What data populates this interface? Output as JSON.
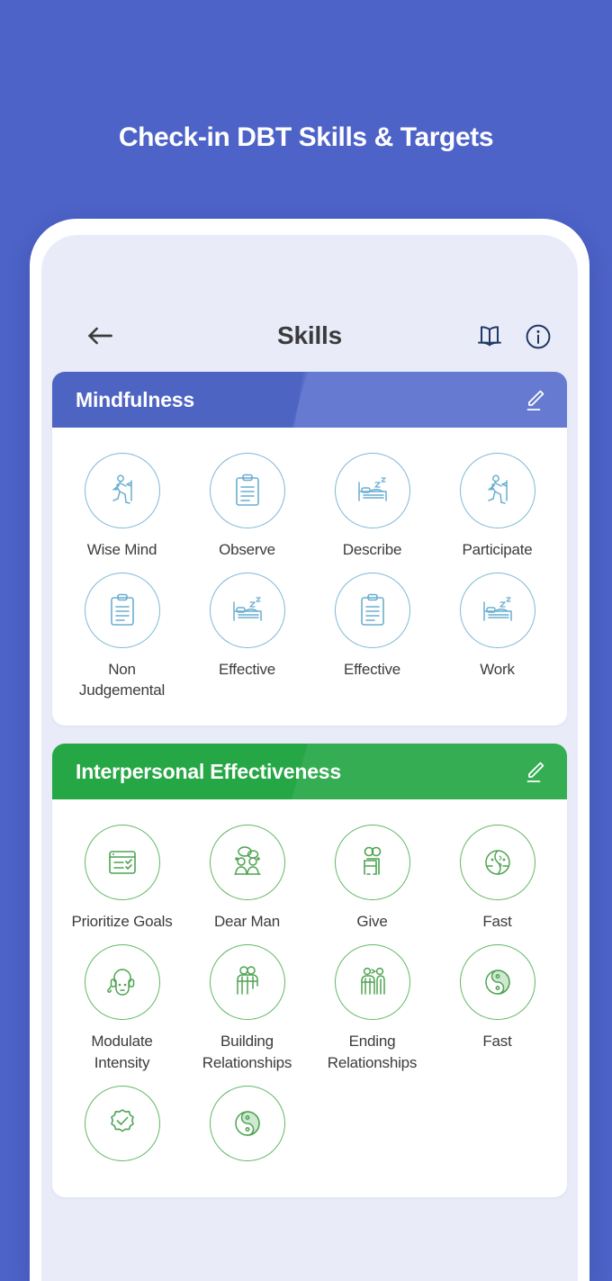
{
  "promo": {
    "title": "Check-in DBT Skills & Targets"
  },
  "colors": {
    "background_blue": "#4d63c8",
    "screen_bg": "#e9ecf8",
    "mindfulness_header": "#5068c4",
    "interpersonal_header": "#26a745",
    "mindfulness_icon": "#7fb9d6",
    "interpersonal_icon": "#4ea352",
    "label_text": "#3c3c3c",
    "header_icon": "#1f3864"
  },
  "app_header": {
    "title": "Skills",
    "back_icon": "back-arrow-icon",
    "book_icon": "book-icon",
    "info_icon": "info-icon"
  },
  "sections": [
    {
      "title": "Mindfulness",
      "theme": "blue",
      "edit_icon": "pencil-edit-icon",
      "skills": [
        {
          "label": "Wise Mind",
          "icon": "hiker-walking-icon"
        },
        {
          "label": "Observe",
          "icon": "clipboard-icon"
        },
        {
          "label": "Describe",
          "icon": "bed-sleep-icon"
        },
        {
          "label": "Participate",
          "icon": "hiker-walking-icon"
        },
        {
          "label": "Non Judgemental",
          "icon": "clipboard-icon"
        },
        {
          "label": "Effective",
          "icon": "bed-sleep-icon"
        },
        {
          "label": "Effective",
          "icon": "clipboard-icon"
        },
        {
          "label": "Work",
          "icon": "bed-sleep-icon"
        }
      ]
    },
    {
      "title": "Interpersonal Effectiveness",
      "theme": "green",
      "edit_icon": "pencil-edit-icon",
      "skills": [
        {
          "label": "Prioritize Goals",
          "icon": "checklist-window-icon"
        },
        {
          "label": "Dear Man",
          "icon": "two-people-talking-icon"
        },
        {
          "label": "Give",
          "icon": "people-at-desk-icon"
        },
        {
          "label": "Fast",
          "icon": "split-face-icon"
        },
        {
          "label": "Modulate Intensity",
          "icon": "head-headphones-icon"
        },
        {
          "label": "Building Relationships",
          "icon": "two-people-together-icon"
        },
        {
          "label": "Ending Relationships",
          "icon": "two-people-apart-icon"
        },
        {
          "label": "Fast",
          "icon": "yin-yang-icon"
        },
        {
          "label": "",
          "icon": "check-badge-icon"
        },
        {
          "label": "",
          "icon": "yin-yang-icon"
        }
      ]
    }
  ]
}
